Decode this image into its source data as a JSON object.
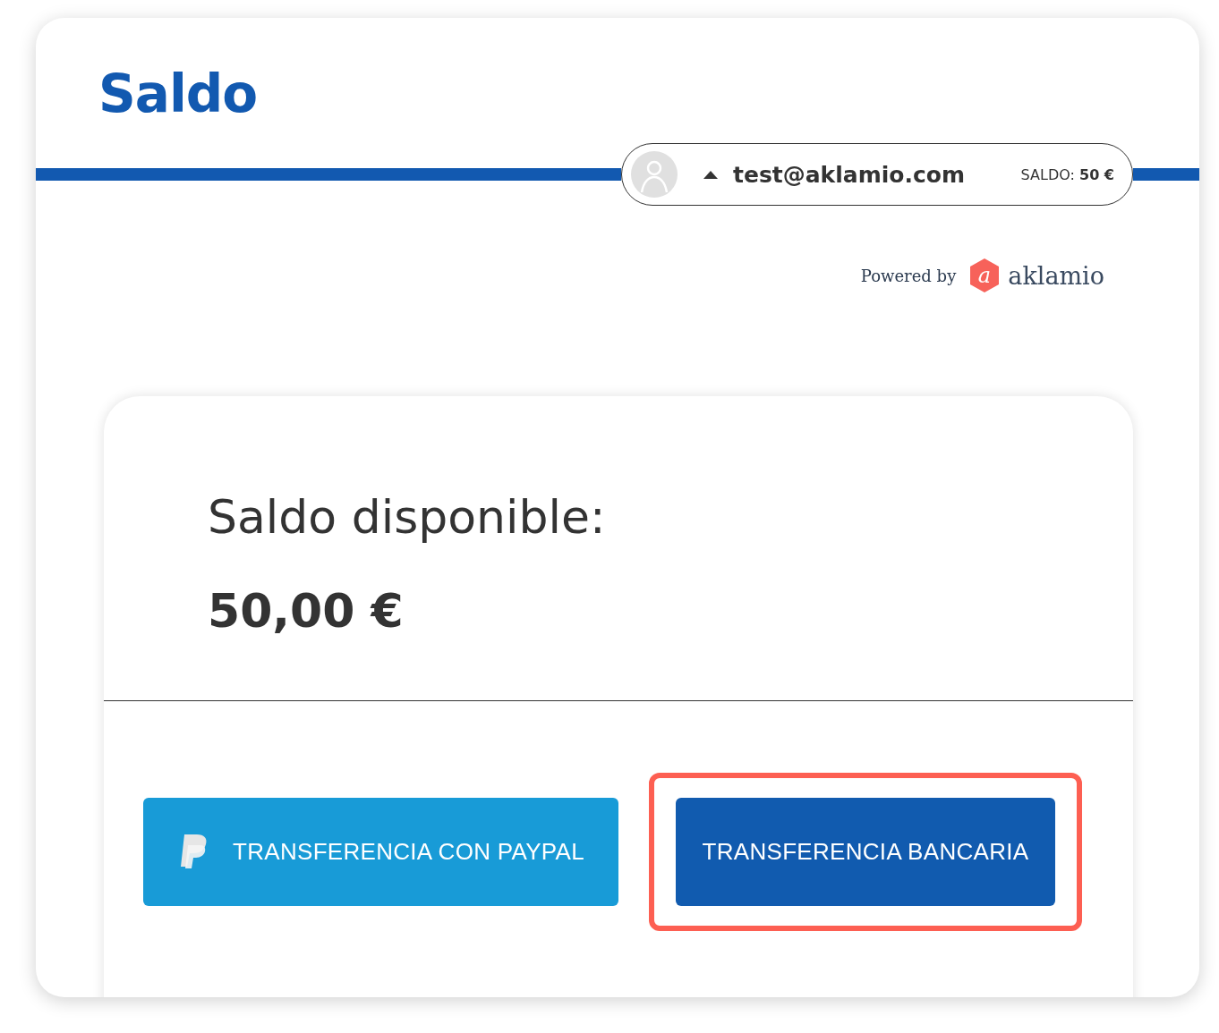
{
  "page": {
    "title": "Saldo"
  },
  "user_menu": {
    "email": "test@aklamio.com",
    "expanded": true,
    "balance_label": "SALDO:",
    "balance_value": "50 €"
  },
  "powered_by": {
    "text": "Powered by",
    "logo_mark": "a",
    "brand": "aklamio"
  },
  "balance_card": {
    "heading": "Saldo disponible:",
    "amount": "50,00 €"
  },
  "buttons": [
    {
      "kind": "paypal",
      "label": "TRANSFERENCIA CON PAYPAL",
      "highlighted": false
    },
    {
      "kind": "bank",
      "label": "TRANSFERENCIA BANCARIA",
      "highlighted": true
    }
  ]
}
